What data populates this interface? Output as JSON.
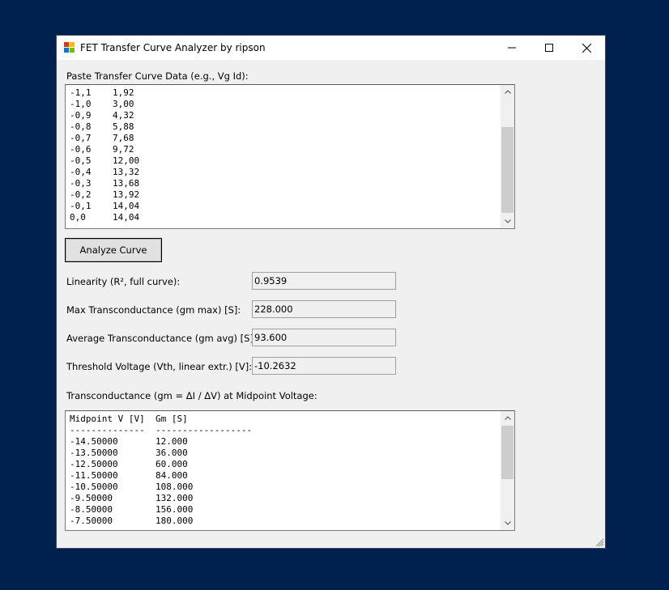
{
  "window": {
    "title": "FET Transfer Curve Analyzer by ripson"
  },
  "input": {
    "label": "Paste Transfer Curve Data (e.g., Vg Id):",
    "text": "-1,1    1,92\n-1,0    3,00\n-0,9    4,32\n-0,8    5,88\n-0,7    7,68\n-0,6    9,72\n-0,5    12,00\n-0,4    13,32\n-0,3    13,68\n-0,2    13,92\n-0,1    14,04\n0,0     14,04"
  },
  "analyze_button": {
    "label": "Analyze Curve"
  },
  "results": [
    {
      "label": "Linearity (R², full curve):",
      "value": "0.9539"
    },
    {
      "label": "Max Transconductance (gm max) [S]:",
      "value": "228.000"
    },
    {
      "label": "Average Transconductance (gm avg) [S]:",
      "value": "93.600"
    },
    {
      "label": "Threshold Voltage (Vth, linear extr.) [V]:",
      "value": "-10.2632"
    }
  ],
  "gm_table": {
    "label": "Transconductance (gm = ΔI / ΔV) at Midpoint Voltage:",
    "text": "Midpoint V [V]  Gm [S]\n--------------  ------------------\n-14.50000       12.000\n-13.50000       36.000\n-12.50000       60.000\n-11.50000       84.000\n-10.50000       108.000\n-9.50000        132.000\n-8.50000        156.000\n-7.50000        180.000"
  },
  "icons": {
    "app": "app-icon",
    "minimize": "minimize-icon",
    "maximize": "maximize-icon",
    "close": "close-icon",
    "scroll_up": "chevron-up-icon",
    "scroll_down": "chevron-down-icon",
    "resize": "resize-grip-icon"
  },
  "colors": {
    "desktop": "#00204f",
    "window_bg": "#f0f0f0",
    "titlebar_bg": "#ffffff",
    "scroll_thumb": "#cdcdcd"
  }
}
